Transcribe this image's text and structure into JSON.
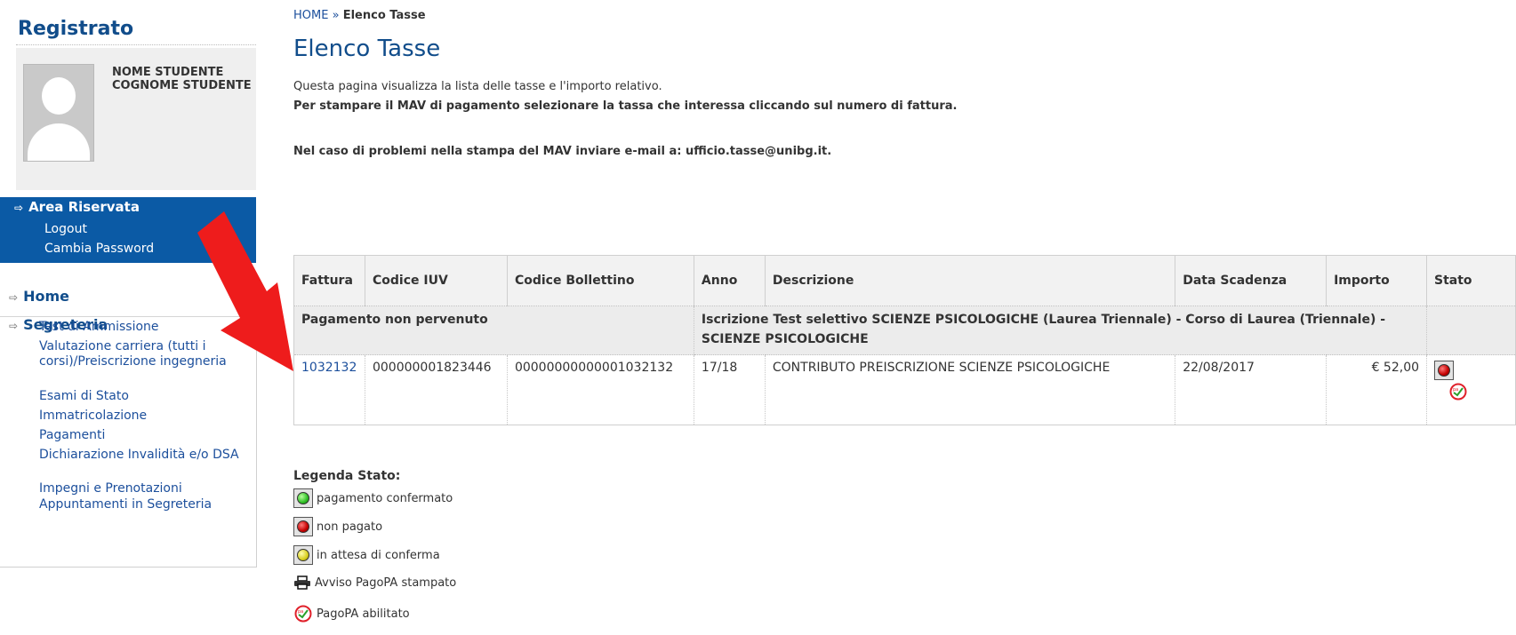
{
  "sidebar": {
    "title": "Registrato",
    "student_name": "NOME STUDENTE COGNOME STUDENTE",
    "area": {
      "title": "Area Riservata",
      "links": [
        "Logout",
        "Cambia Password"
      ]
    },
    "home_label": "Home",
    "segreteria_label": "Segreteria",
    "items": [
      "Test di Ammissione",
      "Valutazione carriera (tutti i corsi)/Preiscrizione ingegneria",
      "Esami di Stato",
      "Immatricolazione",
      "Pagamenti",
      "Dichiarazione Invalidità e/o DSA",
      "Impegni e Prenotazioni",
      "Appuntamenti in Segreteria"
    ]
  },
  "breadcrumb": {
    "home": "HOME",
    "separator": "»",
    "current": "Elenco Tasse"
  },
  "page": {
    "title": "Elenco Tasse",
    "intro_line1": "Questa pagina visualizza la lista delle tasse e l'importo relativo.",
    "intro_line2": "Per stampare il MAV di pagamento selezionare la tassa che interessa cliccando sul numero di fattura.",
    "intro_line3": "Nel caso di problemi nella stampa del MAV inviare e-mail a: ufficio.tasse@unibg.it."
  },
  "table": {
    "headers": [
      "Fattura",
      "Codice IUV",
      "Codice Bollettino",
      "Anno",
      "Descrizione",
      "Data Scadenza",
      "Importo",
      "Stato"
    ],
    "group": {
      "label": "Pagamento non pervenuto",
      "description": "Iscrizione Test selettivo SCIENZE PSICOLOGICHE (Laurea Triennale) - Corso di Laurea (Triennale) - SCIENZE PSICOLOGICHE"
    },
    "rows": [
      {
        "fattura": "1032132",
        "iuv": "000000001823446",
        "bollettino": "00000000000001032132",
        "anno": "17/18",
        "descrizione": "CONTRIBUTO PREISCRIZIONE SCIENZE PSICOLOGICHE",
        "scadenza": "22/08/2017",
        "importo": "€ 52,00",
        "stato": "red-dot-icon"
      }
    ]
  },
  "legend": {
    "title": "Legenda Stato:",
    "items": [
      {
        "icon": "green-dot-icon",
        "label": "pagamento confermato"
      },
      {
        "icon": "red-dot-icon",
        "label": "non pagato"
      },
      {
        "icon": "yellow-dot-icon",
        "label": "in attesa di conferma"
      },
      {
        "icon": "printer-icon",
        "label": "Avviso PagoPA stampato"
      },
      {
        "icon": "pagopa-icon",
        "label": "PagoPA abilitato"
      }
    ]
  },
  "colors": {
    "brand_blue": "#114d8b",
    "sidebar_active": "#0b5aa5",
    "link": "#1c4f9c",
    "annotation_arrow": "#ee1c1c"
  }
}
